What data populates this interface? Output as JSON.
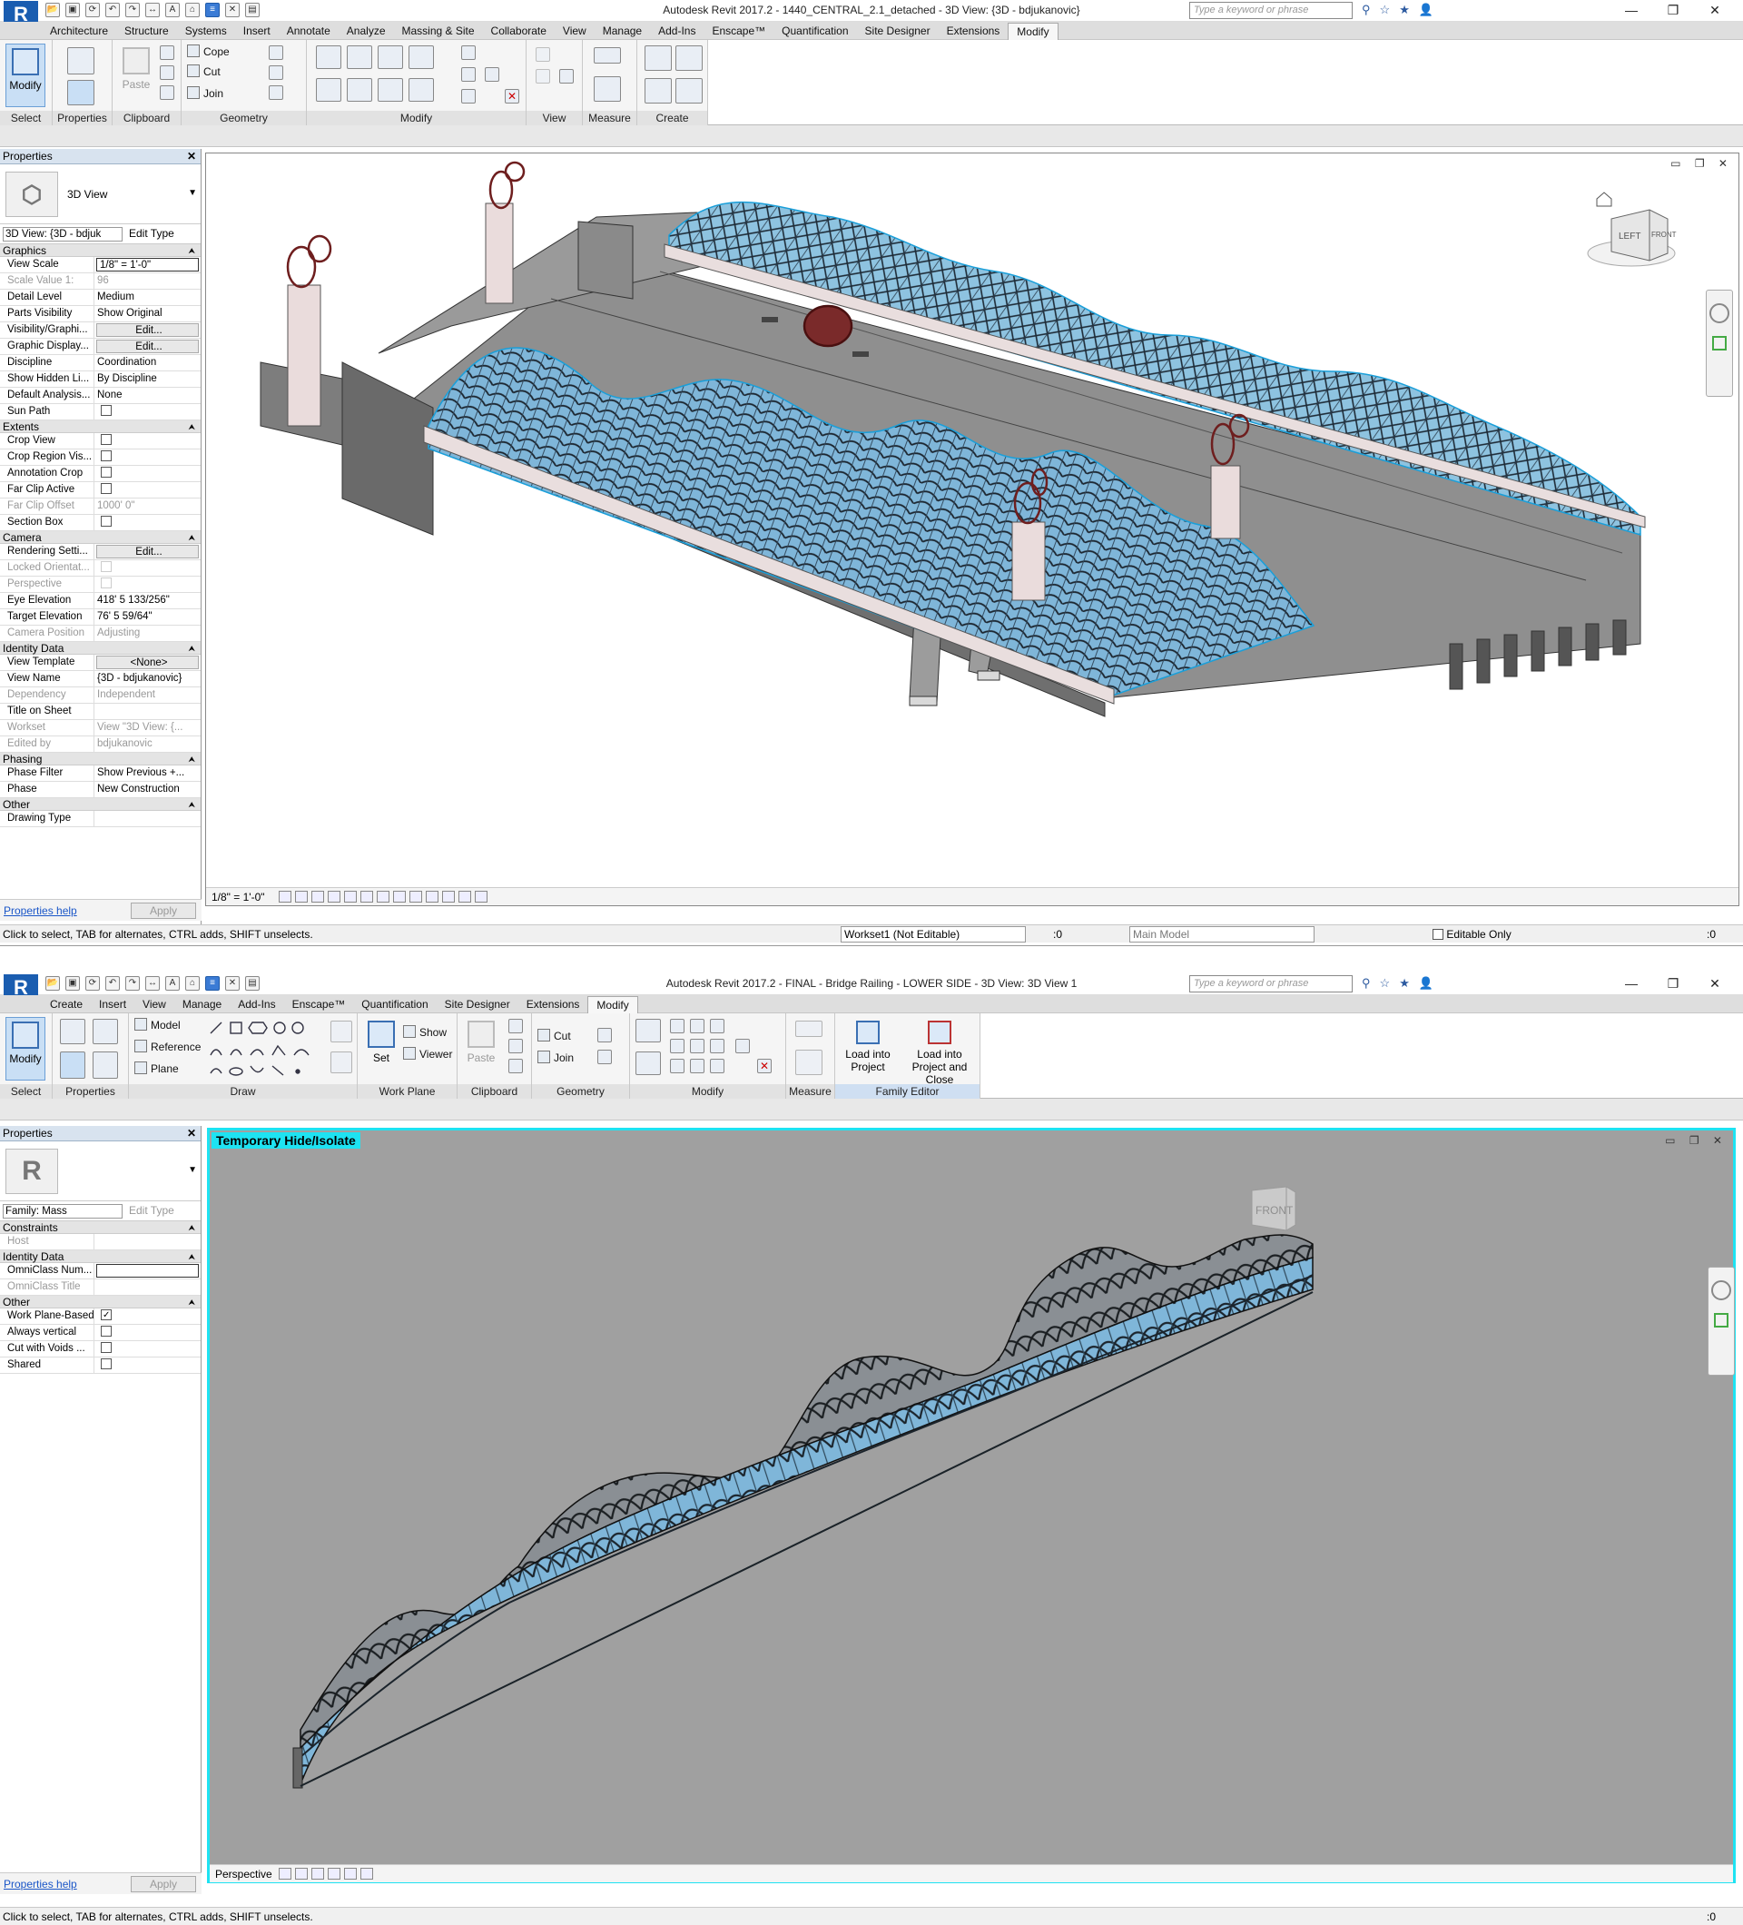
{
  "window1": {
    "title": "Autodesk Revit 2017.2 -    1440_CENTRAL_2.1_detached - 3D View: {3D - bdjukanovic}",
    "search_placeholder": "Type a keyword or phrase",
    "tabs": [
      "Architecture",
      "Structure",
      "Systems",
      "Insert",
      "Annotate",
      "Analyze",
      "Massing & Site",
      "Collaborate",
      "View",
      "Manage",
      "Add-Ins",
      "Enscape™",
      "Quantification",
      "Site Designer",
      "Extensions",
      "Modify"
    ],
    "active_tab": "Modify",
    "ribbon": {
      "select_label": "Select",
      "modify_label": "Modify",
      "panels": [
        "Properties",
        "Clipboard",
        "Geometry",
        "Modify",
        "View",
        "Measure",
        "Create"
      ],
      "paste_label": "Paste",
      "clipboard_items": [
        "Cope",
        "Cut",
        "Join"
      ]
    },
    "properties": {
      "header": "Properties",
      "type_name": "3D View",
      "instance": "3D View: {3D - bdjuk",
      "edit_type": "Edit Type",
      "groups": [
        {
          "name": "Graphics",
          "rows": [
            {
              "n": "View Scale",
              "v": "1/8\" = 1'-0\"",
              "kind": "input"
            },
            {
              "n": "Scale Value    1:",
              "v": "96",
              "kind": "dim"
            },
            {
              "n": "Detail Level",
              "v": "Medium"
            },
            {
              "n": "Parts Visibility",
              "v": "Show Original"
            },
            {
              "n": "Visibility/Graphi...",
              "v": "Edit...",
              "kind": "btn"
            },
            {
              "n": "Graphic Display...",
              "v": "Edit...",
              "kind": "btn"
            },
            {
              "n": "Discipline",
              "v": "Coordination"
            },
            {
              "n": "Show Hidden Li...",
              "v": "By Discipline"
            },
            {
              "n": "Default Analysis...",
              "v": "None"
            },
            {
              "n": "Sun Path",
              "v": "",
              "kind": "cb"
            }
          ]
        },
        {
          "name": "Extents",
          "rows": [
            {
              "n": "Crop View",
              "v": "",
              "kind": "cb"
            },
            {
              "n": "Crop Region Vis...",
              "v": "",
              "kind": "cb"
            },
            {
              "n": "Annotation Crop",
              "v": "",
              "kind": "cb"
            },
            {
              "n": "Far Clip Active",
              "v": "",
              "kind": "cb"
            },
            {
              "n": "Far Clip Offset",
              "v": "1000'  0\"",
              "kind": "dim"
            },
            {
              "n": "Section Box",
              "v": "",
              "kind": "cb"
            }
          ]
        },
        {
          "name": "Camera",
          "rows": [
            {
              "n": "Rendering Setti...",
              "v": "Edit...",
              "kind": "btn"
            },
            {
              "n": "Locked Orientat...",
              "v": "",
              "kind": "cbdim"
            },
            {
              "n": "Perspective",
              "v": "",
              "kind": "cbdim"
            },
            {
              "n": "Eye Elevation",
              "v": "418'  5 133/256\""
            },
            {
              "n": "Target Elevation",
              "v": "76'  5 59/64\""
            },
            {
              "n": "Camera Position",
              "v": "Adjusting",
              "kind": "dim"
            }
          ]
        },
        {
          "name": "Identity Data",
          "rows": [
            {
              "n": "View Template",
              "v": "<None>",
              "kind": "btn"
            },
            {
              "n": "View Name",
              "v": "{3D - bdjukanovic}"
            },
            {
              "n": "Dependency",
              "v": "Independent",
              "kind": "dim"
            },
            {
              "n": "Title on Sheet",
              "v": ""
            },
            {
              "n": "Workset",
              "v": "View \"3D View: {...",
              "kind": "dim"
            },
            {
              "n": "Edited by",
              "v": "bdjukanovic",
              "kind": "dim"
            }
          ]
        },
        {
          "name": "Phasing",
          "rows": [
            {
              "n": "Phase Filter",
              "v": "Show Previous +..."
            },
            {
              "n": "Phase",
              "v": "New Construction"
            }
          ]
        },
        {
          "name": "Other",
          "rows": [
            {
              "n": "Drawing Type",
              "v": ""
            }
          ]
        }
      ],
      "help": "Properties help",
      "apply": "Apply"
    },
    "viewcube": {
      "left": "LEFT",
      "front": "FRONT"
    },
    "view_scale": "1/8\" = 1'-0\"",
    "status": {
      "message": "Click to select, TAB for alternates, CTRL adds, SHIFT unselects.",
      "workset": "Workset1 (Not Editable)",
      "count": ":0",
      "model": "Main Model",
      "editable_only": "Editable Only",
      "filter": ":0"
    }
  },
  "window2": {
    "title": "Autodesk Revit 2017.2 -    FINAL - Bridge Railing - LOWER SIDE - 3D View: 3D View 1",
    "search_placeholder": "Type a keyword or phrase",
    "tabs": [
      "Create",
      "Insert",
      "View",
      "Manage",
      "Add-Ins",
      "Enscape™",
      "Quantification",
      "Site Designer",
      "Extensions",
      "Modify"
    ],
    "active_tab": "Modify",
    "ribbon": {
      "select_label": "Select",
      "modify_label": "Modify",
      "draw_items": [
        "Model",
        "Reference",
        "Plane"
      ],
      "show_label": "Show",
      "viewer_label": "Viewer",
      "set_label": "Set",
      "paste_label": "Paste",
      "geometry_items": [
        "Cut",
        "Join"
      ],
      "load_project": "Load into Project",
      "load_close": "Load into Project and Close",
      "panels": [
        "Properties",
        "Draw",
        "Work Plane",
        "Clipboard",
        "Geometry",
        "Modify",
        "Measure",
        "Family Editor"
      ]
    },
    "properties": {
      "header": "Properties",
      "instance": "Family: Mass",
      "edit_type": "Edit Type",
      "groups": [
        {
          "name": "Constraints",
          "rows": [
            {
              "n": "Host",
              "v": "",
              "kind": "dim"
            }
          ]
        },
        {
          "name": "Identity Data",
          "rows": [
            {
              "n": "OmniClass Num...",
              "v": "",
              "kind": "input"
            },
            {
              "n": "OmniClass Title",
              "v": "",
              "kind": "dim"
            }
          ]
        },
        {
          "name": "Other",
          "rows": [
            {
              "n": "Work Plane-Based",
              "v": "",
              "kind": "cbon"
            },
            {
              "n": "Always vertical",
              "v": "",
              "kind": "cb"
            },
            {
              "n": "Cut with Voids ...",
              "v": "",
              "kind": "cb"
            },
            {
              "n": "Shared",
              "v": "",
              "kind": "cb"
            }
          ]
        }
      ],
      "help": "Properties help",
      "apply": "Apply"
    },
    "badge": "Temporary Hide/Isolate",
    "viewcube": {
      "front": "FRONT"
    },
    "view_mode": "Perspective",
    "status": {
      "message": "Click to select, TAB for alternates, CTRL adds, SHIFT unselects.",
      "filter": ":0"
    }
  },
  "colors": {
    "glass": "#7fb6d9",
    "frame": "#1f2a33",
    "deck": "#8a8a8a",
    "pier": "#e8dede",
    "sculpture": "#7a2a2a",
    "canvas2": "#a0a0a0",
    "accent": "#1ee3f2"
  }
}
